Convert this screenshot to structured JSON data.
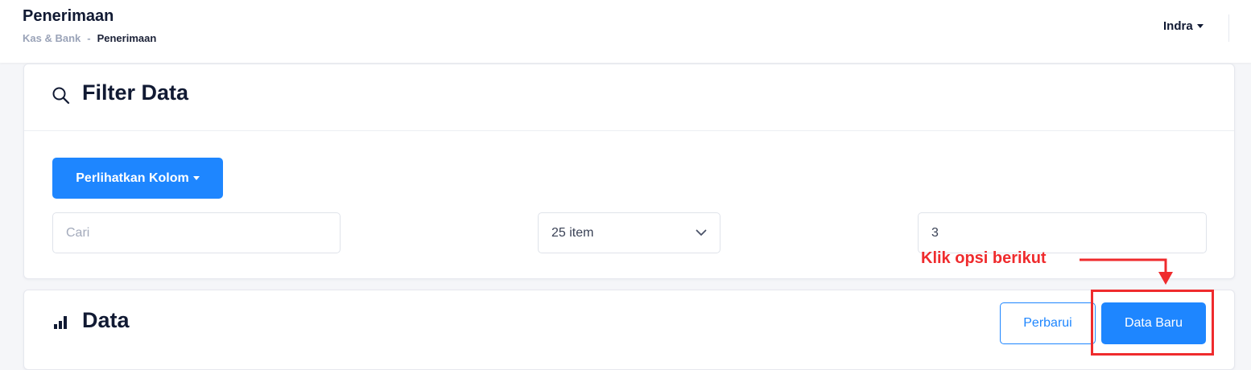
{
  "header": {
    "title": "Penerimaan",
    "breadcrumb": {
      "parent": "Kas & Bank",
      "separator": "-",
      "current": "Penerimaan"
    },
    "user": {
      "name": "Indra"
    }
  },
  "filter_card": {
    "title": "Filter Data",
    "icon": "search-icon",
    "columns_button": "Perlihatkan Kolom",
    "search": {
      "placeholder": "Cari",
      "value": ""
    },
    "page_size": {
      "selected": "25 item"
    },
    "page_number": {
      "value": "3"
    }
  },
  "data_card": {
    "title": "Data",
    "icon": "bar-chart-icon",
    "refresh_button": "Perbarui",
    "new_button": "Data Baru"
  },
  "annotation": {
    "text": "Klik opsi berikut",
    "color": "#ef2b2d"
  },
  "colors": {
    "primary": "#1e86ff",
    "annotation": "#ef2b2d",
    "title": "#111a33",
    "muted": "#9aa3b8"
  }
}
